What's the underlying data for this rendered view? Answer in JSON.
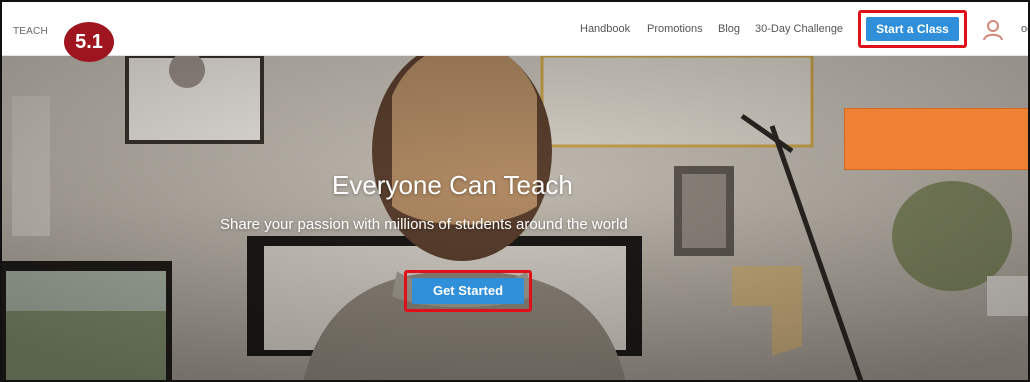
{
  "header": {
    "brand": "TEACH",
    "step_badge": "5.1",
    "nav": [
      "Handbook",
      "Promotions",
      "Blog",
      "30-Day Challenge"
    ],
    "start_class_label": "Start a Class",
    "avatar_icon": "user-icon",
    "user_name": "oc"
  },
  "hero": {
    "title": "Everyone Can Teach",
    "subtitle": "Share your passion with millions of students around the world",
    "cta_label": "Get Started"
  },
  "colors": {
    "primary_button": "#2f8fd8",
    "highlight_outline": "#e0101a",
    "step_badge": "#9e1520",
    "overlay_box": "#ee8133"
  }
}
